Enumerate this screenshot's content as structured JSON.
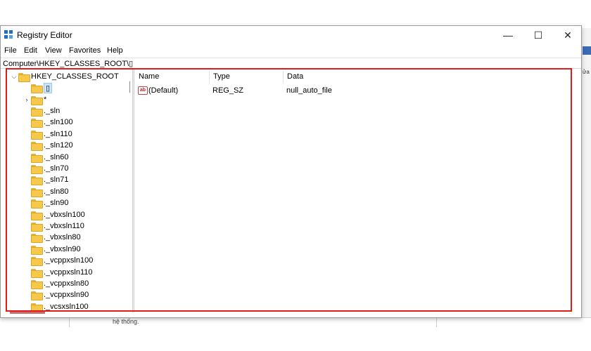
{
  "window": {
    "title": "Registry Editor"
  },
  "controls": {
    "minimize": "—",
    "maximize": "☐",
    "close": "✕"
  },
  "menu": [
    "File",
    "Edit",
    "View",
    "Favorites",
    "Help"
  ],
  "address": "Computer\\HKEY_CLASSES_ROOT\\▯",
  "tree": {
    "root": "HKEY_CLASSES_ROOT",
    "items": [
      {
        "label": "▯",
        "selected": true,
        "expander": ""
      },
      {
        "label": "*",
        "expander": "›"
      },
      {
        "label": "._sln"
      },
      {
        "label": "._sln100"
      },
      {
        "label": "._sln110"
      },
      {
        "label": "._sln120"
      },
      {
        "label": "._sln60"
      },
      {
        "label": "._sln70"
      },
      {
        "label": "._sln71"
      },
      {
        "label": "._sln80"
      },
      {
        "label": "._sln90"
      },
      {
        "label": "._vbxsln100"
      },
      {
        "label": "._vbxsln110"
      },
      {
        "label": "._vbxsln80"
      },
      {
        "label": "._vbxsln90"
      },
      {
        "label": "._vcppxsln100"
      },
      {
        "label": "._vcppxsln110"
      },
      {
        "label": "._vcppxsln80"
      },
      {
        "label": "._vcppxsln90"
      },
      {
        "label": "._vcsxsln100"
      }
    ]
  },
  "list": {
    "columns": {
      "name": "Name",
      "type": "Type",
      "data": "Data"
    },
    "rows": [
      {
        "icon": "ab",
        "name": "(Default)",
        "type": "REG_SZ",
        "data": "null_auto_file"
      }
    ]
  },
  "background": {
    "status_text": "hệ thống.",
    "side_text": "ửa"
  },
  "colors": {
    "highlight": "#e01b1b",
    "selection": "#cce4f7",
    "folder": "#f6c94a"
  }
}
